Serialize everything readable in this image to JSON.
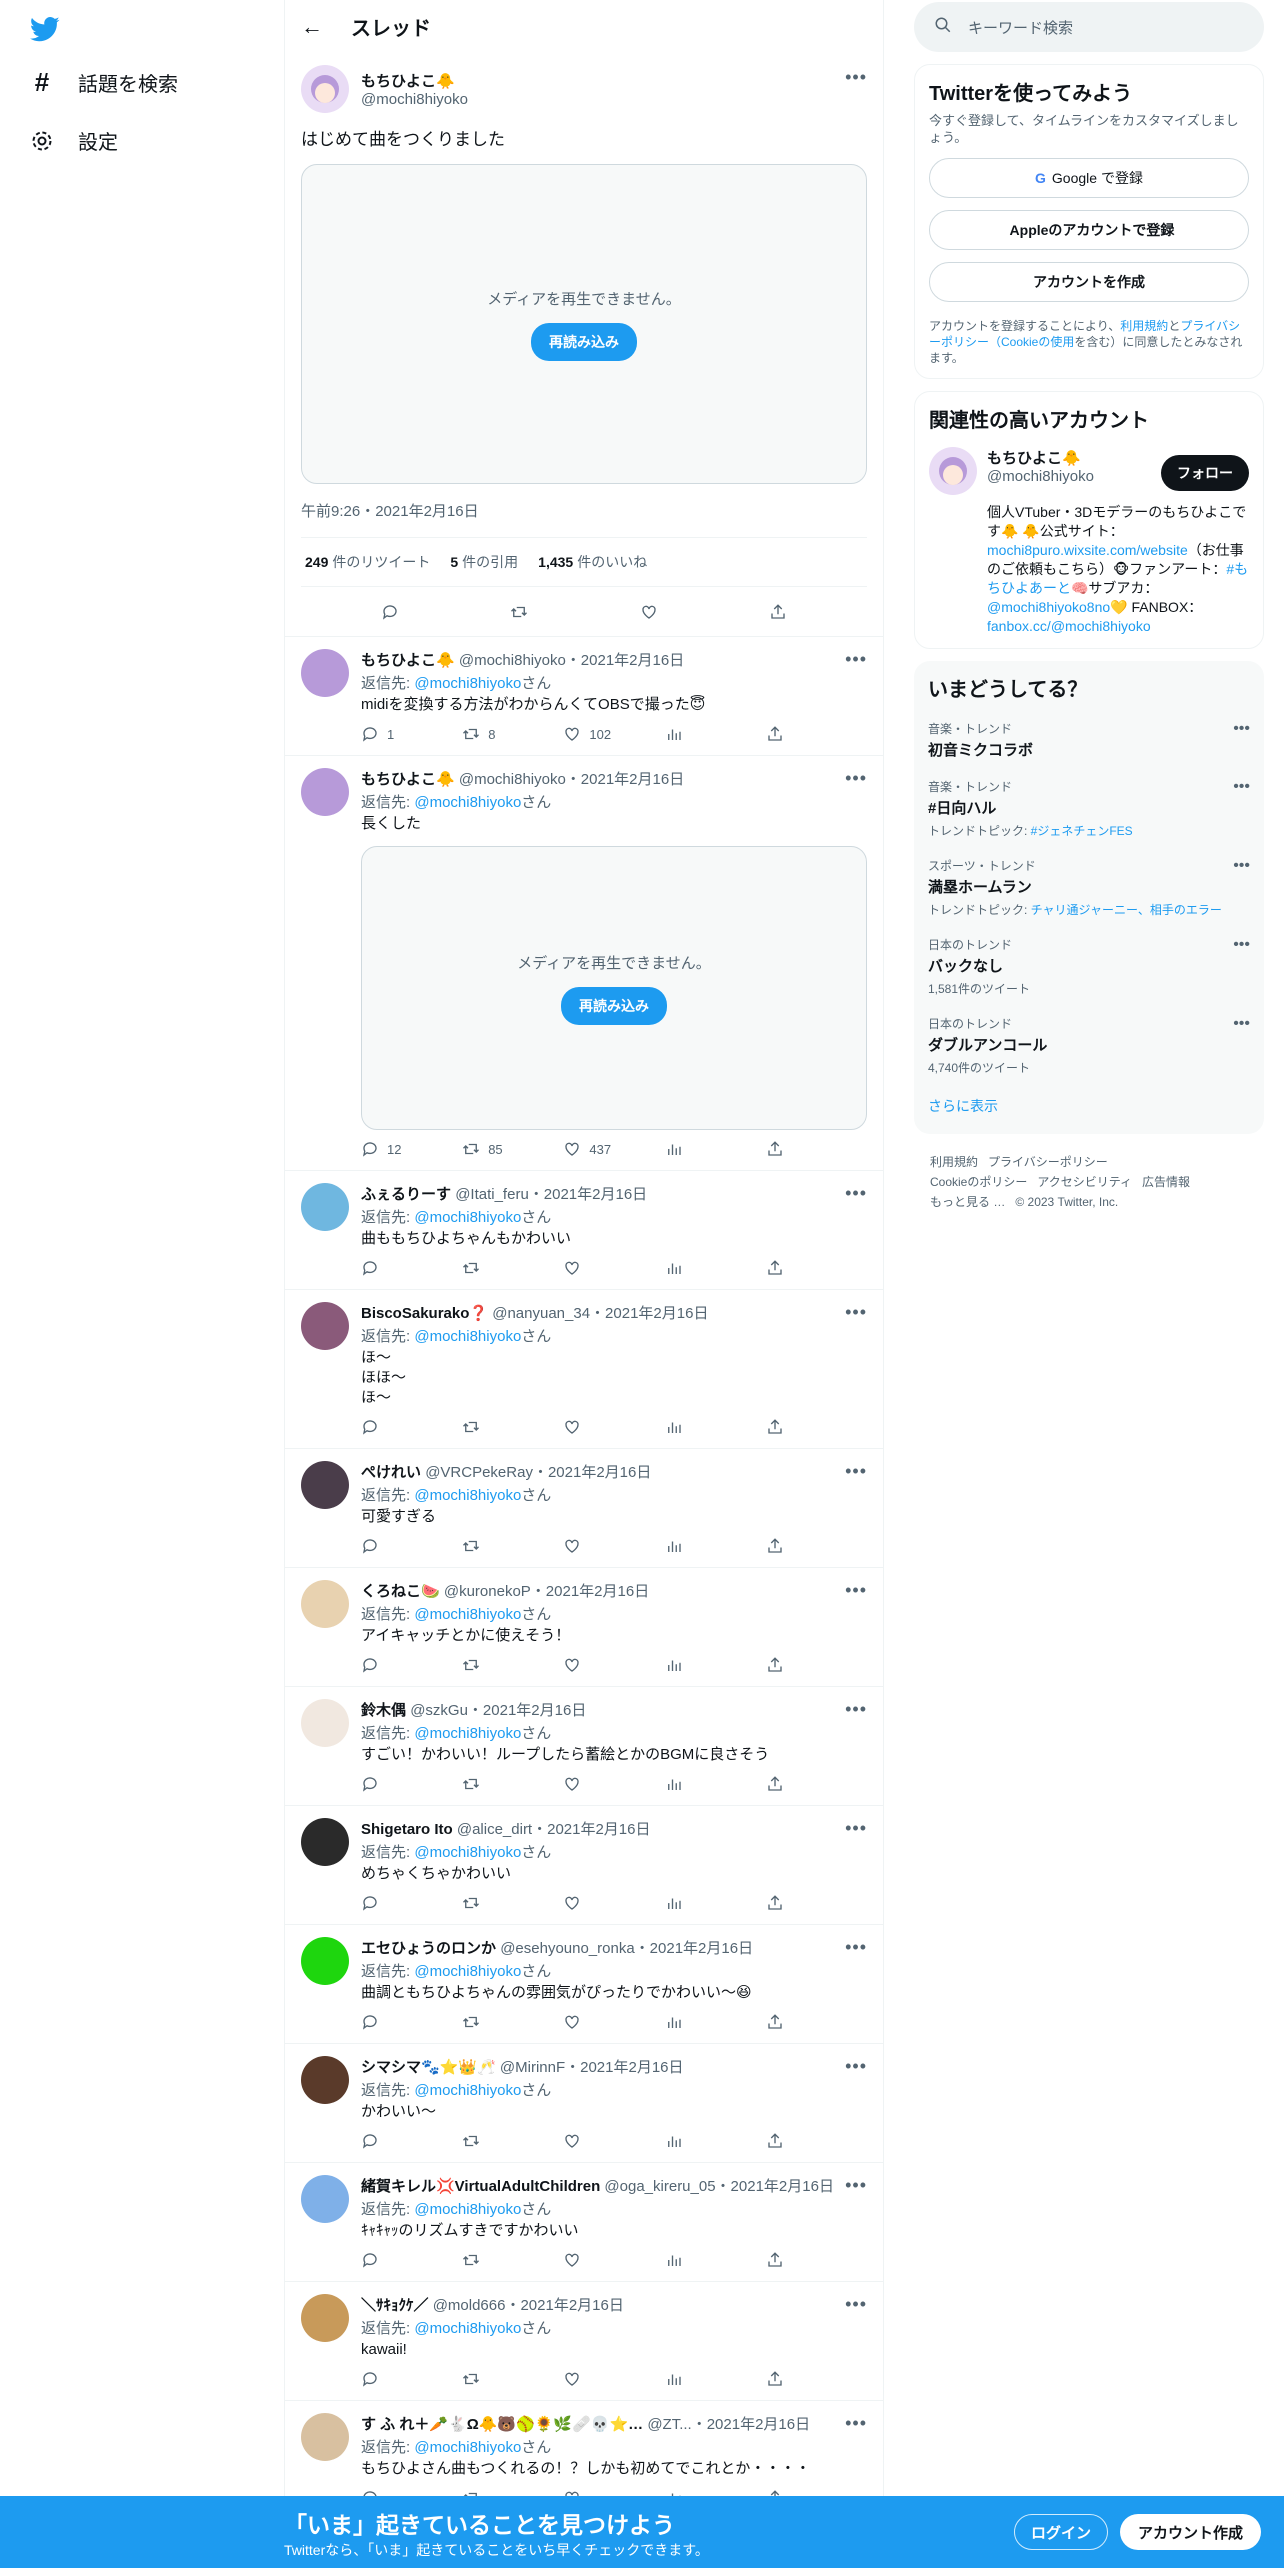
{
  "nav": {
    "explore_label": "話題を検索",
    "settings_label": "設定"
  },
  "header": {
    "title": "スレッド"
  },
  "main_tweet": {
    "name": "もちひよこ🐥",
    "handle": "@mochi8hiyoko",
    "text": "はじめて曲をつくりました",
    "media_message": "メディアを再生できません。",
    "reload_label": "再読み込み",
    "timestamp": "午前9:26・2021年2月16日",
    "retweets": "249",
    "retweets_label": "件のリツイート",
    "quotes": "5",
    "quotes_label": "件の引用",
    "likes": "1,435",
    "likes_label": "件のいいね"
  },
  "reply_to_label": "返信先: ",
  "reply_to_suffix": "さん",
  "replies": [
    {
      "name": "もちひよこ🐥",
      "meta": "@mochi8hiyoko・2021年2月16日",
      "to": "@mochi8hiyoko",
      "text": "midiを変換する方法がわからんくてOBSで撮った😇",
      "c": "1",
      "r": "8",
      "l": "102",
      "avatar": "#b79ad9"
    },
    {
      "name": "もちひよこ🐥",
      "meta": "@mochi8hiyoko・2021年2月16日",
      "to": "@mochi8hiyoko",
      "text": "長くした",
      "c": "12",
      "r": "85",
      "l": "437",
      "avatar": "#b79ad9",
      "media": true
    },
    {
      "name": "ふぇるりーす",
      "meta": "@Itati_feru・2021年2月16日",
      "to": "@mochi8hiyoko",
      "text": "曲ももちひよちゃんもかわいい",
      "c": "",
      "r": "",
      "l": "",
      "avatar": "#6fb7e0"
    },
    {
      "name": "BiscoSakurako❓",
      "meta": "@nanyuan_34・2021年2月16日",
      "to": "@mochi8hiyoko",
      "text": "ほ～\nほほ～\nほ～",
      "c": "",
      "r": "",
      "l": "",
      "avatar": "#8a5a7a"
    },
    {
      "name": "ぺけれい",
      "meta": "@VRCPekeRay・2021年2月16日",
      "to": "@mochi8hiyoko",
      "text": "可愛すぎる",
      "c": "",
      "r": "",
      "l": "",
      "avatar": "#4a3d4a"
    },
    {
      "name": "くろねこ🍉",
      "meta": "@kuronekoP・2021年2月16日",
      "to": "@mochi8hiyoko",
      "text": "アイキャッチとかに使えそう！",
      "c": "",
      "r": "",
      "l": "",
      "avatar": "#e8d2b0"
    },
    {
      "name": "鈴木偶",
      "meta": "@szkGu・2021年2月16日",
      "to": "@mochi8hiyoko",
      "text": "すごい！かわいい！ループしたら蓄絵とかのBGMに良さそう",
      "c": "",
      "r": "",
      "l": "",
      "avatar": "#f1e8e0"
    },
    {
      "name": "Shigetaro Ito",
      "meta": "@alice_dirt・2021年2月16日",
      "to": "@mochi8hiyoko",
      "text": "めちゃくちゃかわいい",
      "c": "",
      "r": "",
      "l": "",
      "avatar": "#2a2a2a"
    },
    {
      "name": "エセひょうのロンか",
      "meta": "@esehyouno_ronka・2021年2月16日",
      "to": "@mochi8hiyoko",
      "text": "曲調ともちひよちゃんの雰囲気がぴったりでかわいい～😆",
      "c": "",
      "r": "",
      "l": "",
      "avatar": "#1ed60e"
    },
    {
      "name": "シマシマ🐾⭐👑🥂",
      "meta": "@MirinnF・2021年2月16日",
      "to": "@mochi8hiyoko",
      "text": "かわいい〜",
      "c": "",
      "r": "",
      "l": "",
      "avatar": "#5a3a2a"
    },
    {
      "name": "緒賀キレル💢VirtualAdultChildren",
      "meta": "@oga_kireru_05・2021年2月16日",
      "to": "@mochi8hiyoko",
      "text": "ｷｬｷｬｯのリズムすきですかわいい",
      "c": "",
      "r": "",
      "l": "",
      "avatar": "#7fb0e8"
    },
    {
      "name": "＼ｻｷｮｸｹ／",
      "meta": "@mold666・2021年2月16日",
      "to": "@mochi8hiyoko",
      "text": "kawaii!",
      "c": "",
      "r": "",
      "l": "",
      "avatar": "#c89a5a"
    },
    {
      "name": "す ふ れ＋🥕🐇Ω🐥🐻🥎🌻🌿🩹💀⭐…",
      "meta": "@ZT...・2021年2月16日",
      "to": "@mochi8hiyoko",
      "text": "もちひよさん曲もつくれるの！？しかも初めてでこれとか・・・・",
      "c": "",
      "r": "",
      "l": "",
      "avatar": "#d8c0a0"
    }
  ],
  "right": {
    "search_placeholder": "キーワード検索",
    "signup": {
      "title": "Twitterを使ってみよう",
      "desc": "今すぐ登録して、タイムラインをカスタマイズしましょう。",
      "google": "Google で登録",
      "apple": "Appleのアカウントで登録",
      "create": "アカウントを作成",
      "terms_1": "アカウントを登録することにより、",
      "terms_link_1": "利用規約",
      "terms_2": "と",
      "terms_link_2": "プライバシーポリシー（Cookieの使用",
      "terms_3": "を含む）に同意したとみなされます。"
    },
    "related": {
      "title": "関連性の高いアカウント",
      "name": "もちひよこ🐥",
      "handle": "@mochi8hiyoko",
      "follow": "フォロー",
      "bio_1": "個人VTuber・3Dモデラーのもちひよこです🐥 🐥公式サイト：",
      "bio_link_1": "mochi8puro.wixsite.com/website",
      "bio_2": "（お仕事のご依頼もこちら）🐵ファンアート：",
      "bio_link_2": "#もちひよあーと",
      "bio_3": "🧠サブアカ：",
      "bio_link_3": "@mochi8hiyoko8no",
      "bio_4": "💛 FANBOX：",
      "bio_link_4": "fanbox.cc/@mochi8hiyoko"
    },
    "trends": {
      "title": "いまどうしてる？",
      "items": [
        {
          "cat": "音楽・トレンド",
          "title": "初音ミクコラボ",
          "sub": "",
          "sub_link": ""
        },
        {
          "cat": "音楽・トレンド",
          "title": "#日向ハル",
          "sub": "トレンドトピック: ",
          "sub_link": "#ジェネチェンFES"
        },
        {
          "cat": "スポーツ・トレンド",
          "title": "満塁ホームラン",
          "sub": "トレンドトピック: ",
          "sub_link": "チャリ通ジャーニー、相手のエラー"
        },
        {
          "cat": "日本のトレンド",
          "title": "バックなし",
          "sub": "1,581件のツイート",
          "sub_link": ""
        },
        {
          "cat": "日本のトレンド",
          "title": "ダブルアンコール",
          "sub": "4,740件のツイート",
          "sub_link": ""
        }
      ],
      "show_more": "さらに表示"
    },
    "footer": {
      "line1": [
        "利用規約",
        "プライバシーポリシー"
      ],
      "line2": [
        "Cookieのポリシー",
        "アクセシビリティ",
        "広告情報"
      ],
      "line3": [
        "もっと見る …",
        "© 2023 Twitter, Inc."
      ]
    }
  },
  "bottom_bar": {
    "title": "「いま」起きていることを見つけよう",
    "subtitle": "Twitterなら、「いま」起きていることをいち早くチェックできます。",
    "login": "ログイン",
    "signup": "アカウント作成"
  },
  "colors": {
    "accent": "#1d9bf0",
    "text": "#0f1419",
    "muted": "#536471"
  }
}
